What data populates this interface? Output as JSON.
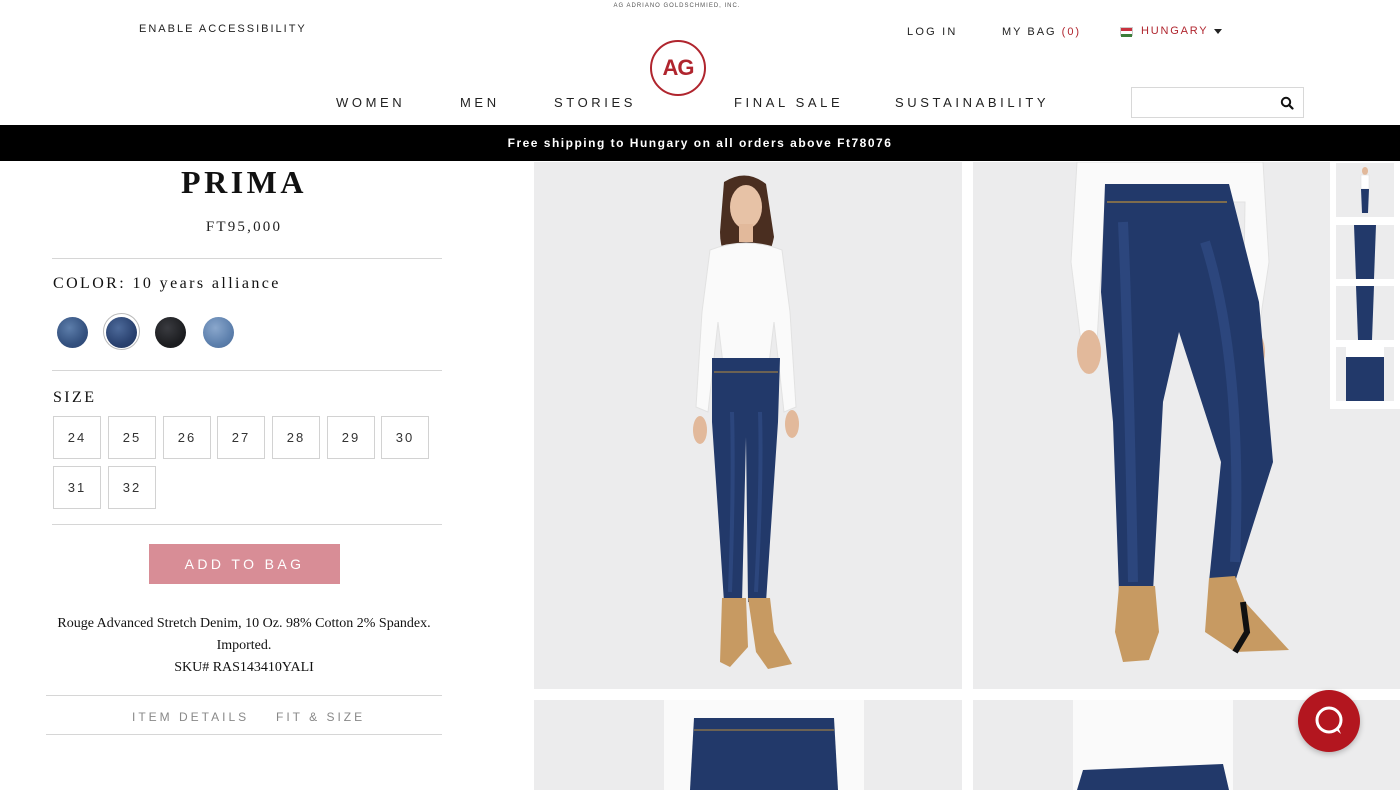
{
  "header": {
    "tagline": "AG ADRIANO GOLDSCHMIED, INC.",
    "accessibility_label": "ENABLE ACCESSIBILITY",
    "login_label": "LOG IN",
    "bag_label": "MY BAG",
    "bag_count": "(0)",
    "country_label": "HUNGARY",
    "logo_text": "AG",
    "search_placeholder": ""
  },
  "nav": {
    "items": [
      {
        "label": "WOMEN"
      },
      {
        "label": "MEN"
      },
      {
        "label": "STORIES"
      },
      {
        "label": "FINAL SALE"
      },
      {
        "label": "SUSTAINABILITY"
      }
    ]
  },
  "promo": {
    "text": "Free shipping to Hungary on all orders above Ft78076"
  },
  "product": {
    "name": "PRIMA",
    "price": "FT95,000",
    "color_label": "COLOR:",
    "color_value": "10 years alliance",
    "swatches": [
      {
        "name": "medium-wash",
        "color": "#3e5e8e"
      },
      {
        "name": "10-years-alliance",
        "color": "#2a4270",
        "selected": true
      },
      {
        "name": "black",
        "color": "#1b1c1f"
      },
      {
        "name": "light-wash",
        "color": "#5d80ad"
      }
    ],
    "size_label": "SIZE",
    "sizes": [
      "24",
      "25",
      "26",
      "27",
      "28",
      "29",
      "30",
      "31",
      "32"
    ],
    "add_to_bag_label": "ADD TO BAG",
    "description_line1": "Rouge Advanced Stretch Denim, 10 Oz. 98% Cotton 2% Spandex.",
    "description_line2": "Imported.",
    "sku": "SKU# RAS143410YALI",
    "tabs": [
      {
        "label": "ITEM DETAILS"
      },
      {
        "label": "FIT & SIZE"
      }
    ]
  },
  "colors": {
    "brand_red": "#b0252e",
    "add_to_bag_bg": "#d88d96",
    "chat_bg": "#b3161f",
    "denim": "#22396a"
  },
  "icons": {
    "search": "search-icon",
    "chat": "chat-icon",
    "caret": "caret-down-icon",
    "flag": "hungary-flag-icon"
  }
}
